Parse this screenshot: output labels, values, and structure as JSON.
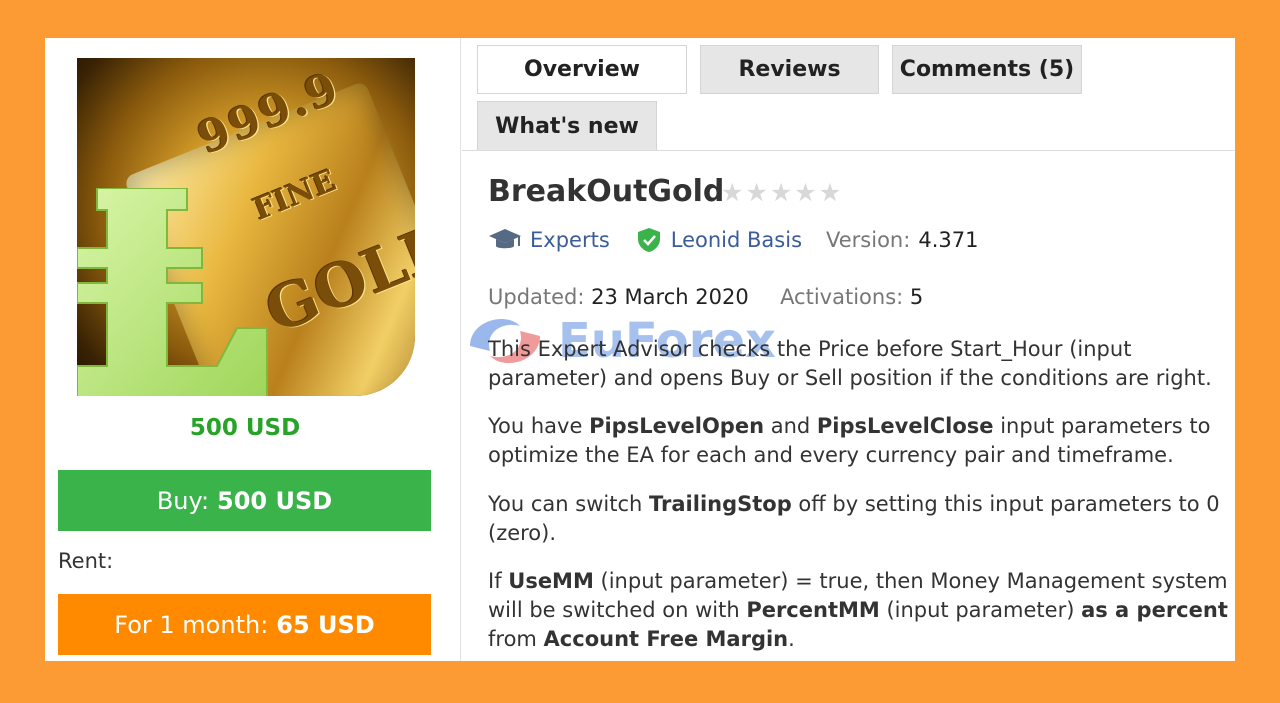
{
  "tabs": {
    "overview": "Overview",
    "reviews": "Reviews",
    "comments": "Comments (5)",
    "whats_new": "What's new"
  },
  "product": {
    "image_text": {
      "purity": "999.9",
      "fine": "FINE",
      "gold": "GOLD"
    },
    "price": "500 USD",
    "buy_prefix": "Buy:",
    "buy_amount": "500 USD",
    "rent_label": "Rent:",
    "rent_prefix": "For 1 month:",
    "rent_amount": "65 USD"
  },
  "title": "BreakOutGold",
  "rating_stars": 0,
  "meta": {
    "category": "Experts",
    "author": "Leonid Basis",
    "version_label": "Version:",
    "version": "4.371",
    "updated_label": "Updated:",
    "updated": "23 March 2020",
    "activations_label": "Activations:",
    "activations": "5"
  },
  "description": {
    "p1": "This Expert Advisor checks the Price before Start_Hour (input parameter) and opens Buy or Sell position if the conditions are right.",
    "p2_a": "You have ",
    "p2_b": "PipsLevelOpen",
    "p2_c": " and ",
    "p2_d": "PipsLevelClose",
    "p2_e": " input parameters to optimize the EA for each and every currency pair and timeframe.",
    "p3_a": "You can switch ",
    "p3_b": "TrailingStop",
    "p3_c": " off by setting this input parameters to 0 (zero).",
    "p4_a": "If ",
    "p4_b": "UseMM",
    "p4_c": " (input parameter) = true, then Money Management system will be switched on with ",
    "p4_d": "PercentMM",
    "p4_e": " (input parameter) ",
    "p4_f": "as a percent",
    "p4_g": " from ",
    "p4_h": "Account Free Margin",
    "p4_i": "."
  },
  "watermark": "EuForex",
  "colors": {
    "background": "#fc9a33",
    "buy": "#3ab34a",
    "rent": "#ff8a00",
    "price": "#27a329",
    "link": "#3a5d99"
  }
}
